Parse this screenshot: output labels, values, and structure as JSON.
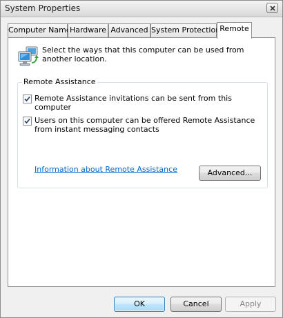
{
  "window": {
    "title": "System Properties"
  },
  "titlebar": {
    "close_icon": "close-icon"
  },
  "tabs": [
    {
      "label": "Computer Name",
      "active": false
    },
    {
      "label": "Hardware",
      "active": false
    },
    {
      "label": "Advanced",
      "active": false
    },
    {
      "label": "System Protection",
      "active": false
    },
    {
      "label": "Remote",
      "active": true
    }
  ],
  "remote": {
    "intro_icon": "remote-computer-icon",
    "intro_text": "Select the ways that this computer can be used from another location.",
    "assistance_group": {
      "title": "Remote Assistance",
      "options": [
        {
          "label": "Remote Assistance invitations can be sent from this computer",
          "checked": true
        },
        {
          "label": "Users on this computer can be offered Remote Assistance from instant messaging contacts",
          "checked": true
        }
      ],
      "info_link": "Information about Remote Assistance",
      "advanced_button": "Advanced..."
    }
  },
  "footer": {
    "ok": "OK",
    "cancel": "Cancel",
    "apply": "Apply",
    "apply_enabled": false
  },
  "colors": {
    "link": "#0066cc",
    "default_button_border": "#3c7fb1"
  }
}
